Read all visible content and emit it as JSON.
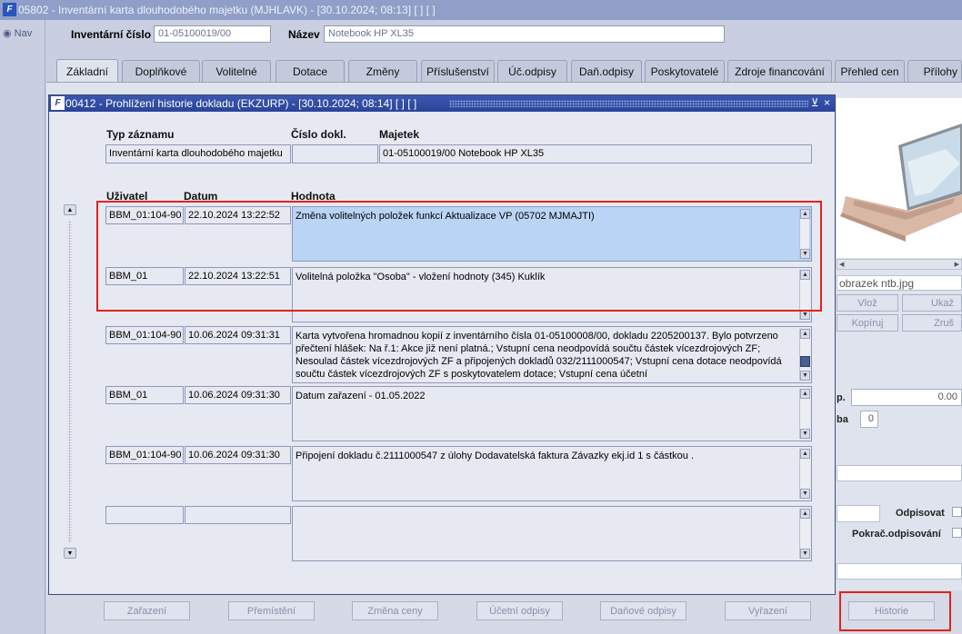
{
  "outer_window": {
    "title": "05802 - Inventární karta dlouhodobého majetku (MJHLAVK) - [30.10.2024; 08:13] [ ] [ ]",
    "nav_label": "Nav"
  },
  "header": {
    "inventory_number_label": "Inventární číslo",
    "inventory_number_value": "01-05100019/00",
    "name_label": "Název",
    "name_value": "Notebook HP XL35"
  },
  "tabs": [
    {
      "label": "Základní"
    },
    {
      "label": "Doplňkové"
    },
    {
      "label": "Volitelné"
    },
    {
      "label": "Dotace"
    },
    {
      "label": "Změny"
    },
    {
      "label": "Příslušenství"
    },
    {
      "label": "Úč.odpisy"
    },
    {
      "label": "Daň.odpisy"
    },
    {
      "label": "Poskytovatelé"
    },
    {
      "label": "Zdroje financování"
    },
    {
      "label": "Přehled cen"
    },
    {
      "label": "Přílohy"
    }
  ],
  "right_panel": {
    "image_filename": "obrazek ntb.jpg",
    "buttons": {
      "insert": "Vlož",
      "show": "Ukaž",
      "copy": "Kopíruj",
      "cancel": "Zruš"
    },
    "field_label_1": "p.",
    "field_value_1": "0.00",
    "field_label_2": "ba",
    "field_value_2": "0",
    "odpisovat_label": "Odpisovat",
    "pokrac_label": "Pokrač.odpisování"
  },
  "bottom_buttons": {
    "zarazeni": "Zařazení",
    "premisteni": "Přemístění",
    "zmena_ceny": "Změna ceny",
    "ucetni_odpisy": "Účetní odpisy",
    "danove_odpisy": "Daňové odpisy",
    "vyrazeni": "Vyřazení",
    "historie": "Historie"
  },
  "dialog": {
    "title": "00412 - Prohlížení historie dokladu (EKZURP) - [30.10.2024; 08:14] [ ] [ ]",
    "controls": "⊻ ×",
    "header_cols": {
      "record_type": "Typ záznamu",
      "doc_number": "Číslo dokl.",
      "asset": "Majetek"
    },
    "header_values": {
      "record_type": "Inventární karta dlouhodobého majetku",
      "doc_number": "",
      "asset": "01-05100019/00 Notebook HP XL35"
    },
    "row_cols": {
      "user": "Uživatel",
      "date": "Datum",
      "value": "Hodnota"
    },
    "rows": [
      {
        "user": "BBM_01:104-90",
        "date": "22.10.2024 13:22:52",
        "value": "Změna volitelných položek funkcí Aktualizace VP (05702 MJMAJTI)"
      },
      {
        "user": "BBM_01",
        "date": "22.10.2024 13:22:51",
        "value": "Volitelná položka \"Osoba\" - vložení hodnoty (345)  Kuklík"
      },
      {
        "user": "BBM_01:104-90",
        "date": "10.06.2024 09:31:31",
        "value": "Karta vytvořena hromadnou kopií z inventárního čísla 01-05100008/00, dokladu 2205200137. Bylo potvrzeno přečtení hlášek: Na ř.1: Akce již není platná.; Vstupní cena neodpovídá součtu částek vícezdrojových ZF; Nesoulad částek vícezdrojových ZF a připojených dokladů 032/2111000547; Vstupní cena dotace neodpovídá součtu částek vícezdrojových ZF s poskytovatelem dotace; Vstupní cena účetní"
      },
      {
        "user": "BBM_01",
        "date": "10.06.2024 09:31:30",
        "value": "Datum zařazení - 01.05.2022"
      },
      {
        "user": "BBM_01:104-90",
        "date": "10.06.2024 09:31:30",
        "value": "Připojení dokladu č.2111000547 z úlohy Dodavatelská faktura Závazky ekj.id 1 s částkou ."
      },
      {
        "user": "",
        "date": "",
        "value": ""
      }
    ]
  }
}
